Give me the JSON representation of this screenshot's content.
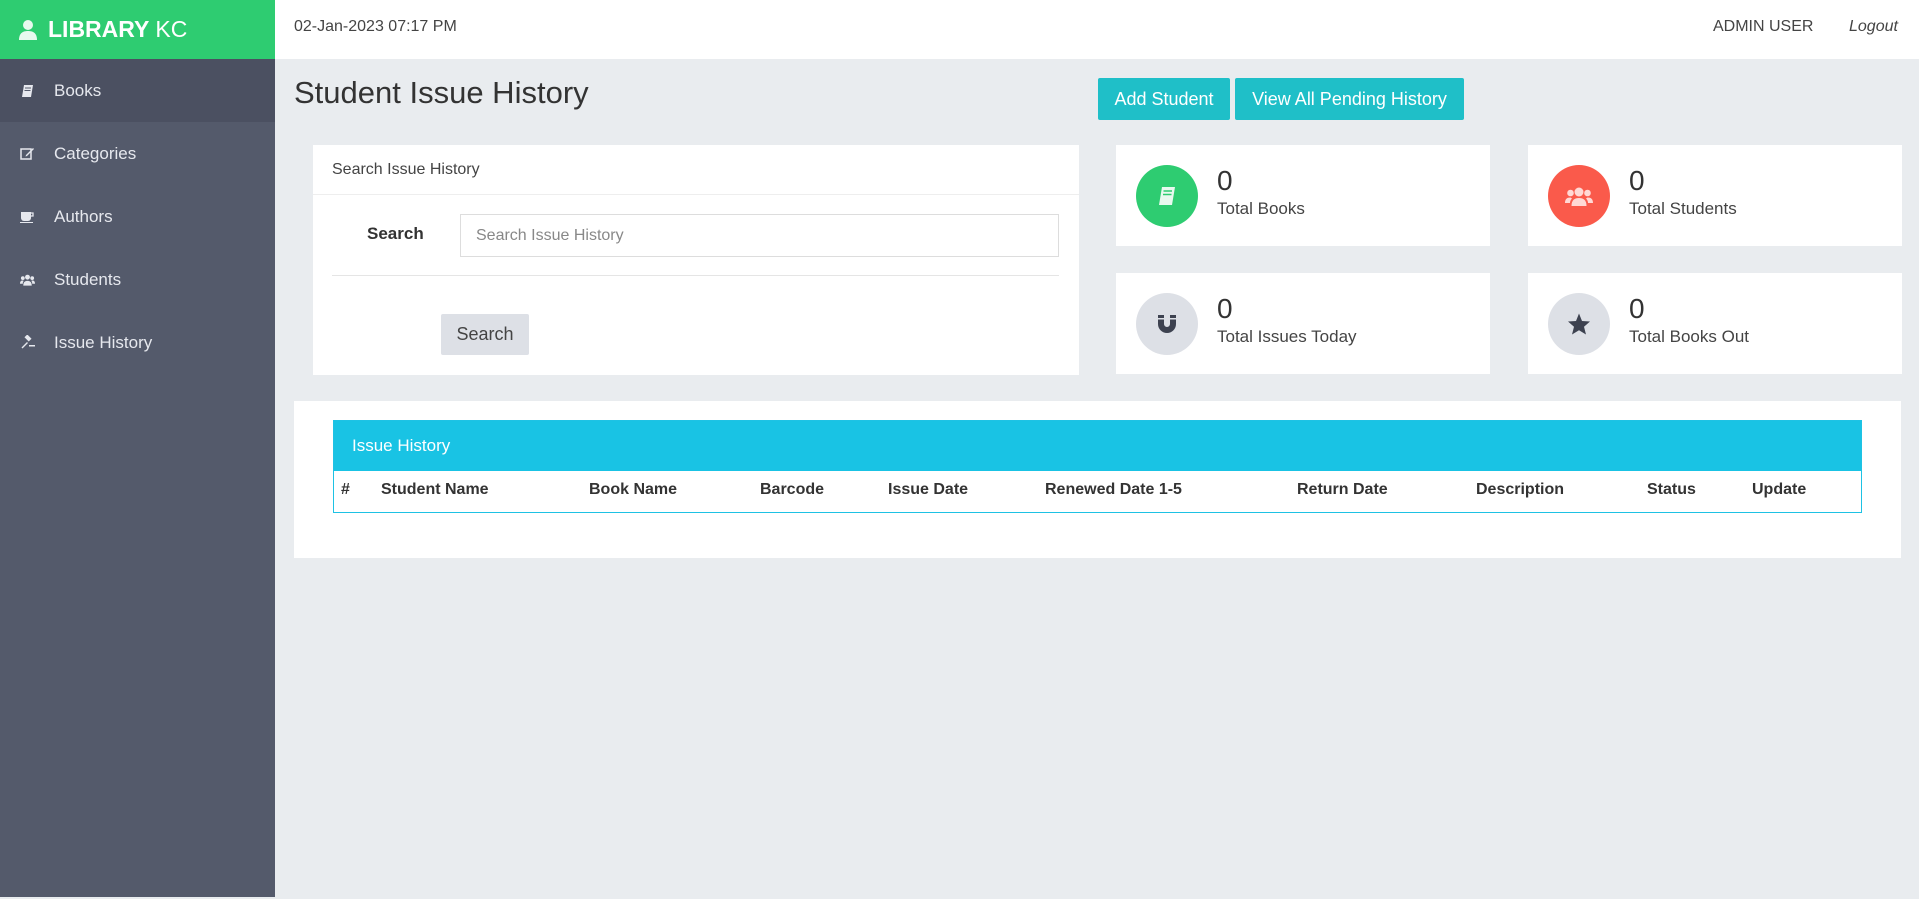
{
  "brand": {
    "name_bold": "LIBRARY",
    "name_light": "KC"
  },
  "sidebar": {
    "items": [
      {
        "label": "Books",
        "icon": "book-icon"
      },
      {
        "label": "Categories",
        "icon": "edit-icon"
      },
      {
        "label": "Authors",
        "icon": "coffee-icon"
      },
      {
        "label": "Students",
        "icon": "users-icon"
      },
      {
        "label": "Issue History",
        "icon": "gavel-icon"
      }
    ]
  },
  "topbar": {
    "datetime": "02-Jan-2023 07:17 PM",
    "user": "ADMIN USER",
    "logout": "Logout"
  },
  "page": {
    "title": "Student Issue History"
  },
  "actions": {
    "add_student": "Add Student",
    "view_pending": "View All Pending History"
  },
  "search": {
    "panel_title": "Search Issue History",
    "label": "Search",
    "placeholder": "Search Issue History",
    "value": "",
    "button": "Search"
  },
  "stats": [
    {
      "value": "0",
      "label": "Total Books",
      "color": "#2ecc71",
      "icon": "book-icon"
    },
    {
      "value": "0",
      "label": "Total Students",
      "color": "#fa5a4b",
      "icon": "users-icon"
    },
    {
      "value": "0",
      "label": "Total Issues Today",
      "color": "#dde0e6",
      "icon": "magnet-icon"
    },
    {
      "value": "0",
      "label": "Total Books Out",
      "color": "#dde0e6",
      "icon": "star-icon"
    }
  ],
  "table": {
    "title": "Issue History",
    "columns": [
      "#",
      "Student Name",
      "Book Name",
      "Barcode",
      "Issue Date",
      "Renewed Date 1-5",
      "Return Date",
      "Description",
      "Status",
      "Update"
    ],
    "rows": []
  },
  "colors": {
    "accent_green": "#2ecc71",
    "sidebar": "#545a6b",
    "teal": "#1fbfc8",
    "table_header": "#19c3e4"
  }
}
